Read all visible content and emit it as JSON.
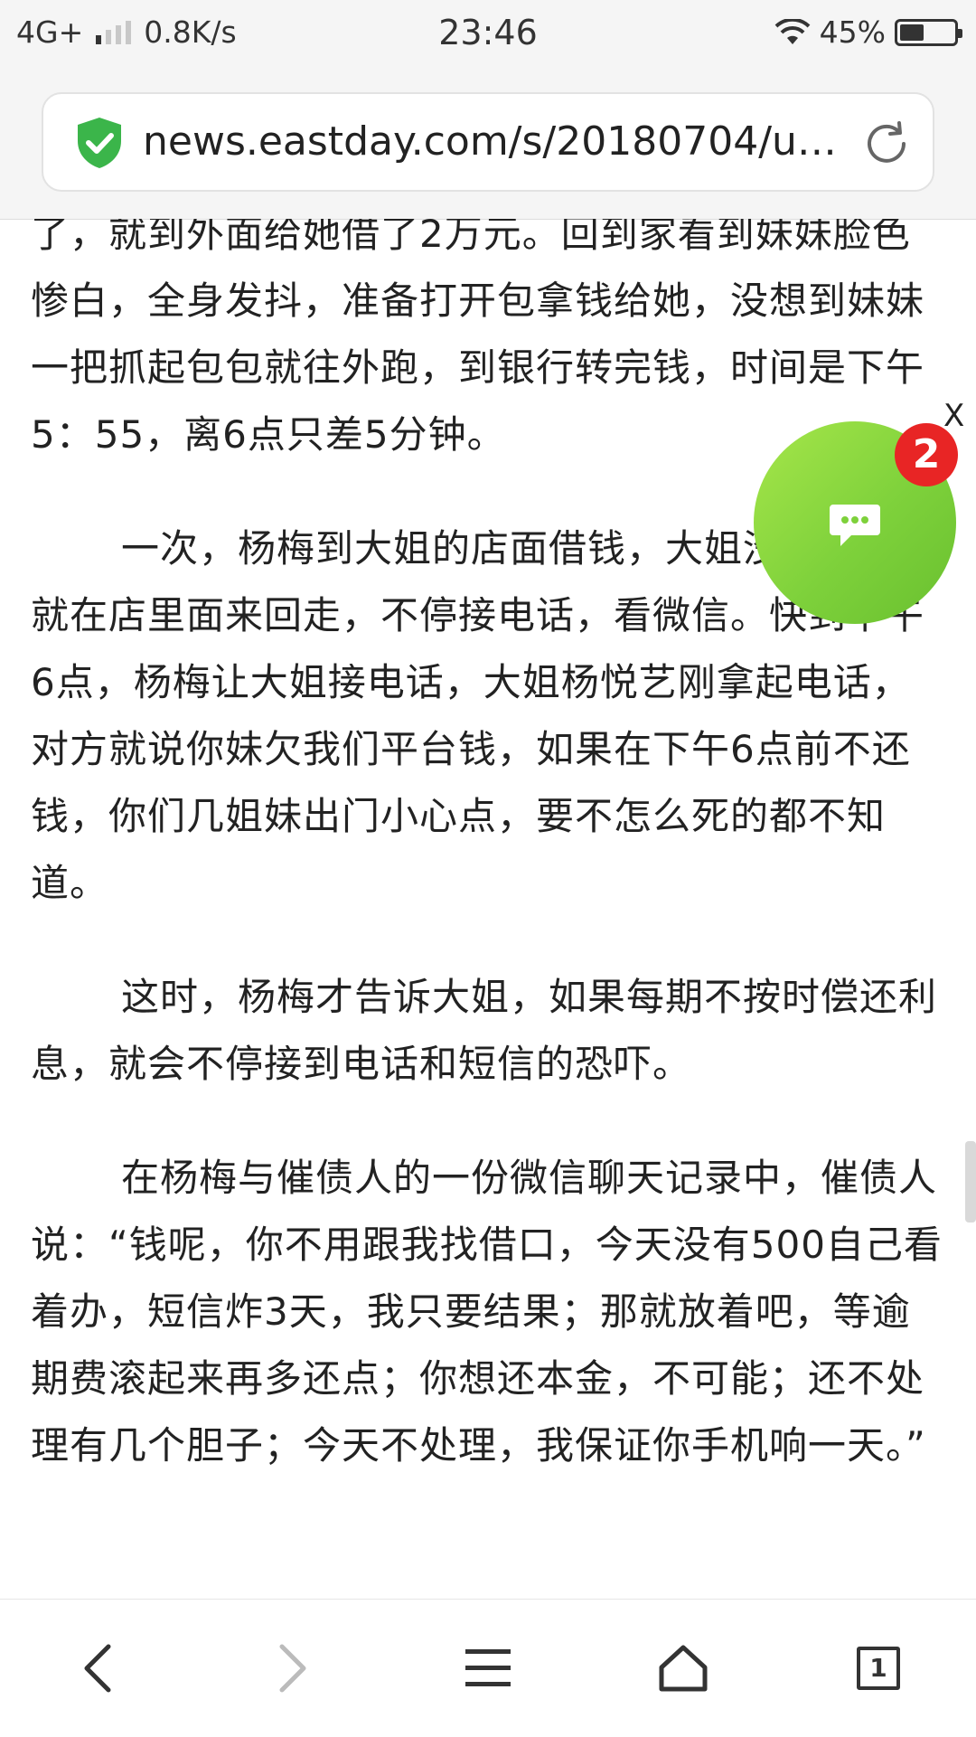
{
  "status_bar": {
    "network": "4G+",
    "speed": "0.8K/s",
    "time": "23:46",
    "battery_percent": "45%",
    "battery_level": 0.45
  },
  "browser": {
    "url": "news.eastday.com/s/20180704/u…",
    "security_icon": "shield-check-icon",
    "reload_icon": "reload-icon"
  },
  "article": {
    "paragraphs": [
      "了，就到外面给她借了2万元。回到家看到妹妹脸色惨白，全身发抖，准备打开包拿钱给她，没想到妹妹一把抓起包包就往外跑，到银行转完钱，时间是下午5：55，离6点只差5分钟。",
      "一次，杨梅到大姐的店面借钱，大姐没钱借，她就在店里面来回走，不停接电话，看微信。快到下午6点，杨梅让大姐接电话，大姐杨悦艺刚拿起电话，对方就说你妹欠我们平台钱，如果在下午6点前不还钱，你们几姐妹出门小心点，要不怎么死的都不知道。",
      "这时，杨梅才告诉大姐，如果每期不按时偿还利息，就会不停接到电话和短信的恐吓。",
      "在杨梅与催债人的一份微信聊天记录中，催债人说：“钱呢，你不用跟我找借口，今天没有500自己看着办，短信炸3天，我只要结果；那就放着吧，等逾期费滚起来再多还点；你想还本金，不可能；还不处理有几个胆子；今天不处理，我保证你手机响一天。”"
    ]
  },
  "chat_widget": {
    "badge_count": "2",
    "close_label": "X",
    "color": "#7ed13b"
  },
  "bottom_nav": {
    "tab_count": "1",
    "icons": [
      "back-icon",
      "forward-icon",
      "menu-icon",
      "home-icon",
      "tabs-icon"
    ]
  }
}
